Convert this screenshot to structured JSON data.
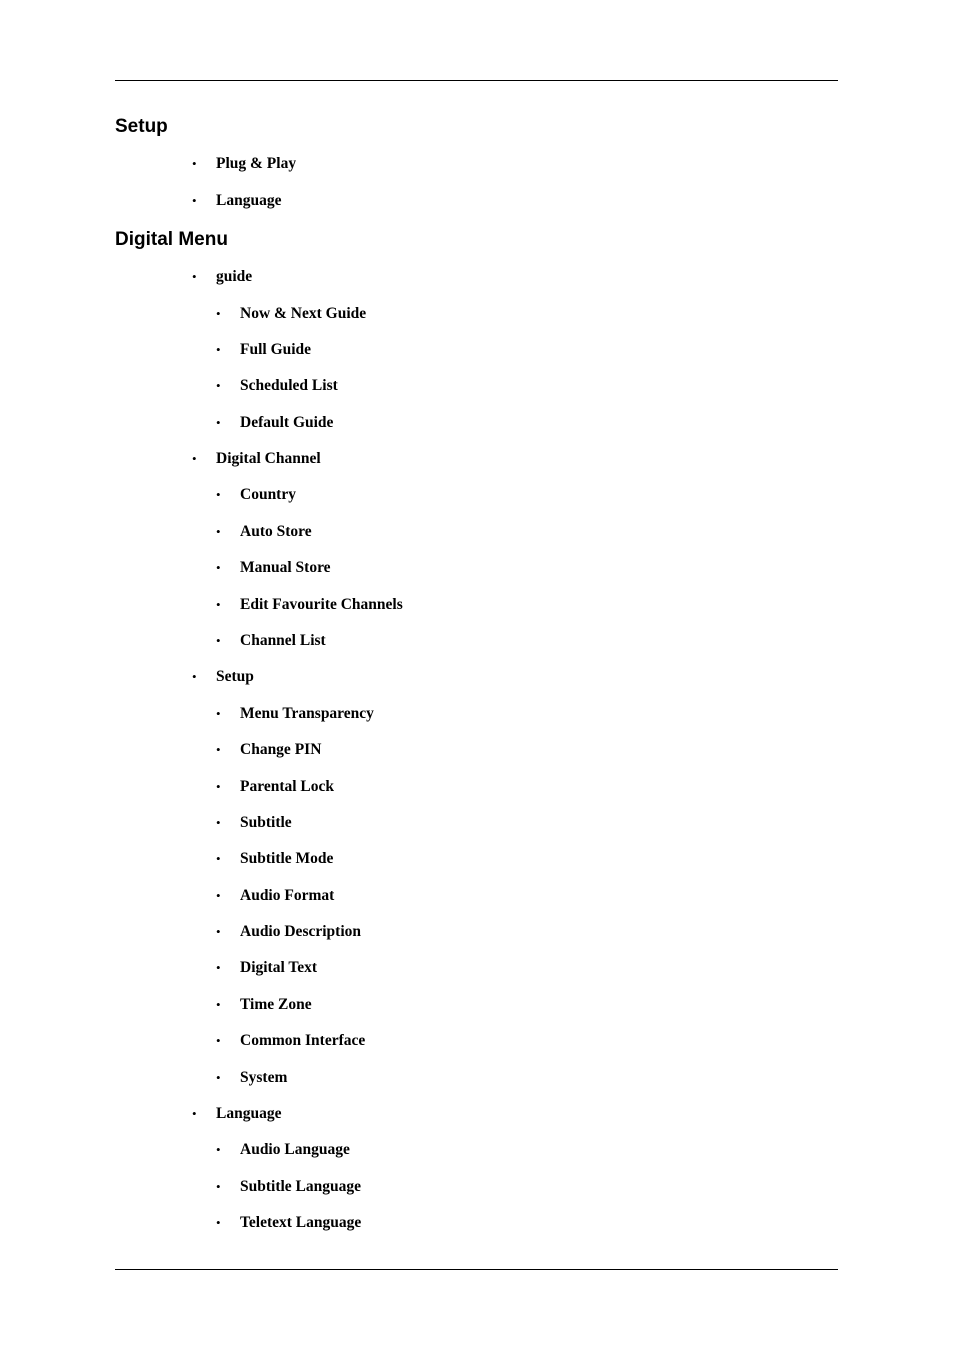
{
  "sections": [
    {
      "title": "Setup",
      "items": [
        {
          "label": "Plug & Play",
          "children": []
        },
        {
          "label": "Language",
          "children": []
        }
      ]
    },
    {
      "title": "Digital Menu",
      "items": [
        {
          "label": "guide",
          "children": [
            "Now & Next Guide",
            "Full Guide",
            "Scheduled List",
            "Default Guide"
          ]
        },
        {
          "label": "Digital Channel",
          "children": [
            "Country",
            "Auto Store",
            "Manual Store",
            "Edit Favourite Channels",
            "Channel List"
          ]
        },
        {
          "label": "Setup",
          "children": [
            "Menu Transparency",
            "Change PIN",
            "Parental Lock",
            "Subtitle",
            "Subtitle Mode",
            "Audio Format",
            "Audio Description",
            "Digital Text",
            "Time Zone",
            "Common Interface",
            "System"
          ]
        },
        {
          "label": "Language",
          "children": [
            "Audio Language",
            "Subtitle Language",
            "Teletext Language"
          ]
        }
      ]
    }
  ],
  "bullet_glyph": "•"
}
